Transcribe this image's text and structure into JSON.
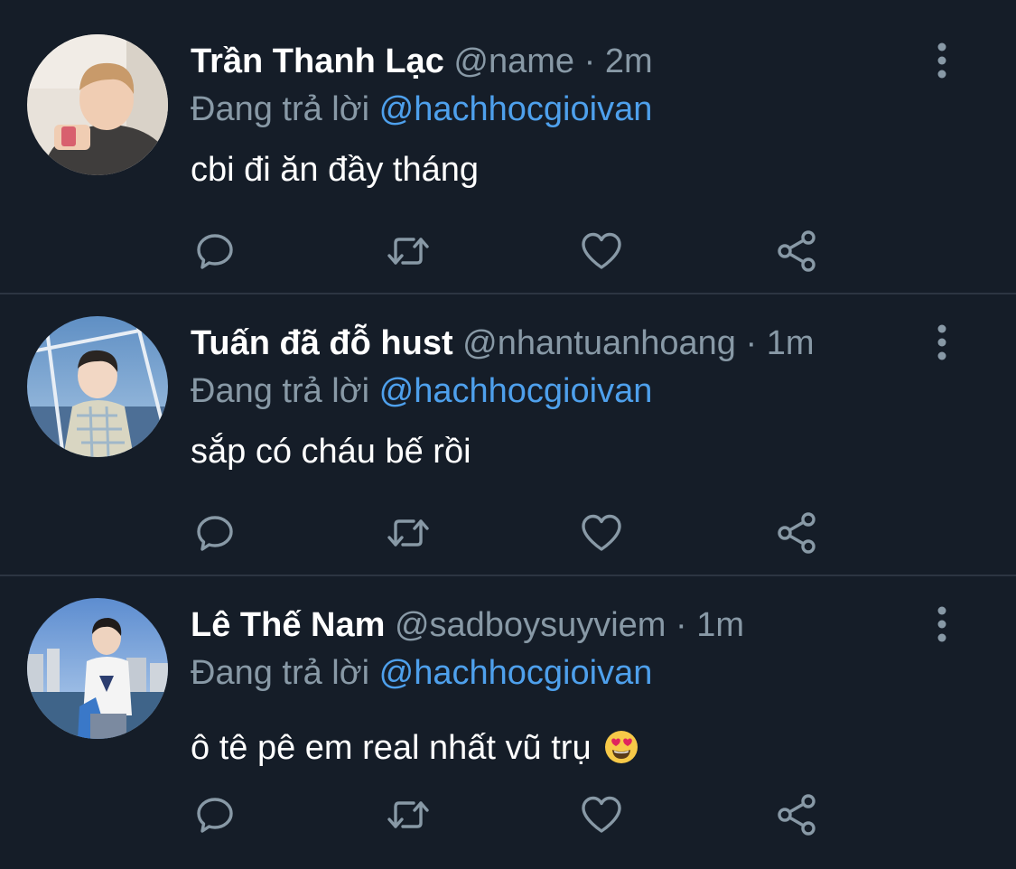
{
  "tweets": [
    {
      "name": "Trần Thanh Lạc",
      "handle": "@name",
      "separator": "·",
      "time": "2m",
      "reply_prefix": "Đang trả lời",
      "reply_to": "@hachhocgioivan",
      "text": "cbi đi ăn đầy tháng",
      "emoji": null
    },
    {
      "name": "Tuấn đã đỗ hust",
      "handle": "@nhantuanhoang",
      "separator": "·",
      "time": "1m",
      "reply_prefix": "Đang trả lời",
      "reply_to": "@hachhocgioivan",
      "text": "sắp có cháu bế rồi",
      "emoji": null
    },
    {
      "name": "Lê Thế Nam",
      "handle": "@sadboysuyviem",
      "separator": "·",
      "time": "1m",
      "reply_prefix": "Đang trả lời",
      "reply_to": "@hachhocgioivan",
      "text": "ô tê pê em real nhất vũ trụ",
      "emoji": "heart-eyes-emoji"
    }
  ],
  "icons": {
    "reply": "reply-icon",
    "retweet": "retweet-icon",
    "like": "heart-icon",
    "share": "share-icon",
    "more": "more-vertical-icon"
  },
  "colors": {
    "background": "#151d28",
    "divider": "#2c3542",
    "secondary_text": "#8899a6",
    "mention": "#4ea0ec",
    "icon": "#8899a6"
  }
}
